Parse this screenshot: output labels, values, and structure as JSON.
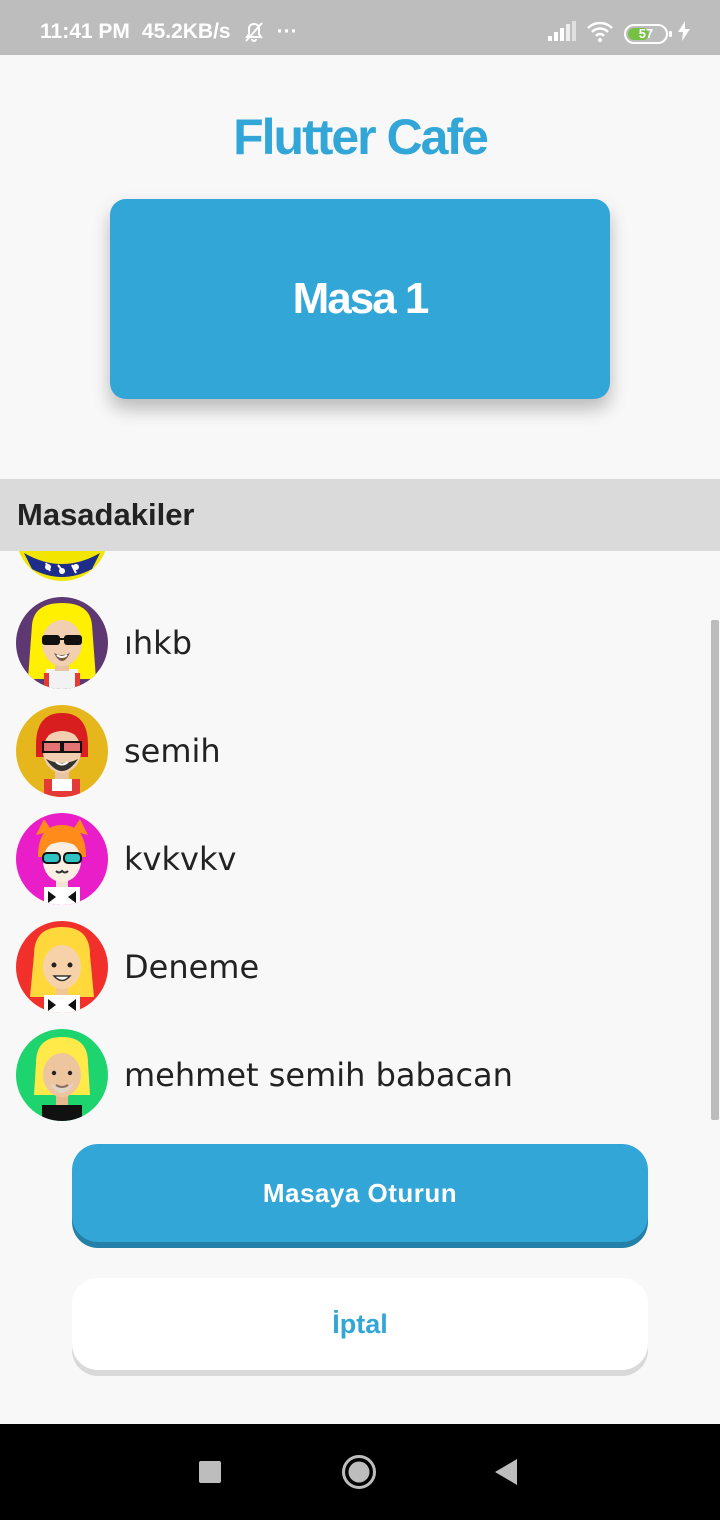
{
  "status_bar": {
    "time": "11:41 PM",
    "speed": "45.2KB/s",
    "more": "···",
    "battery_level": "57",
    "icons": [
      "bell-off-icon",
      "signal-icon",
      "wifi-icon",
      "battery-icon",
      "charging-icon"
    ]
  },
  "header": {
    "title": "Flutter Cafe"
  },
  "table_card": {
    "label": "Masa 1"
  },
  "section": {
    "title": "Masadakiler"
  },
  "people": [
    {
      "name": "",
      "avatar": "partial-avatar"
    },
    {
      "name": "ıhkb",
      "avatar": "blonde-sunglasses-avatar"
    },
    {
      "name": "semih",
      "avatar": "red-hair-sunglasses-avatar"
    },
    {
      "name": "kvkvkv",
      "avatar": "cat-ears-avatar"
    },
    {
      "name": "Deneme",
      "avatar": "blonde-smile-avatar"
    },
    {
      "name": "mehmet semih babacan",
      "avatar": "blonde-beard-avatar"
    }
  ],
  "buttons": {
    "join": "Masaya Oturun",
    "cancel": "İptal"
  },
  "colors": {
    "accent": "#33a6d8",
    "header_bg": "#dadada",
    "background": "#f8f8f8"
  }
}
